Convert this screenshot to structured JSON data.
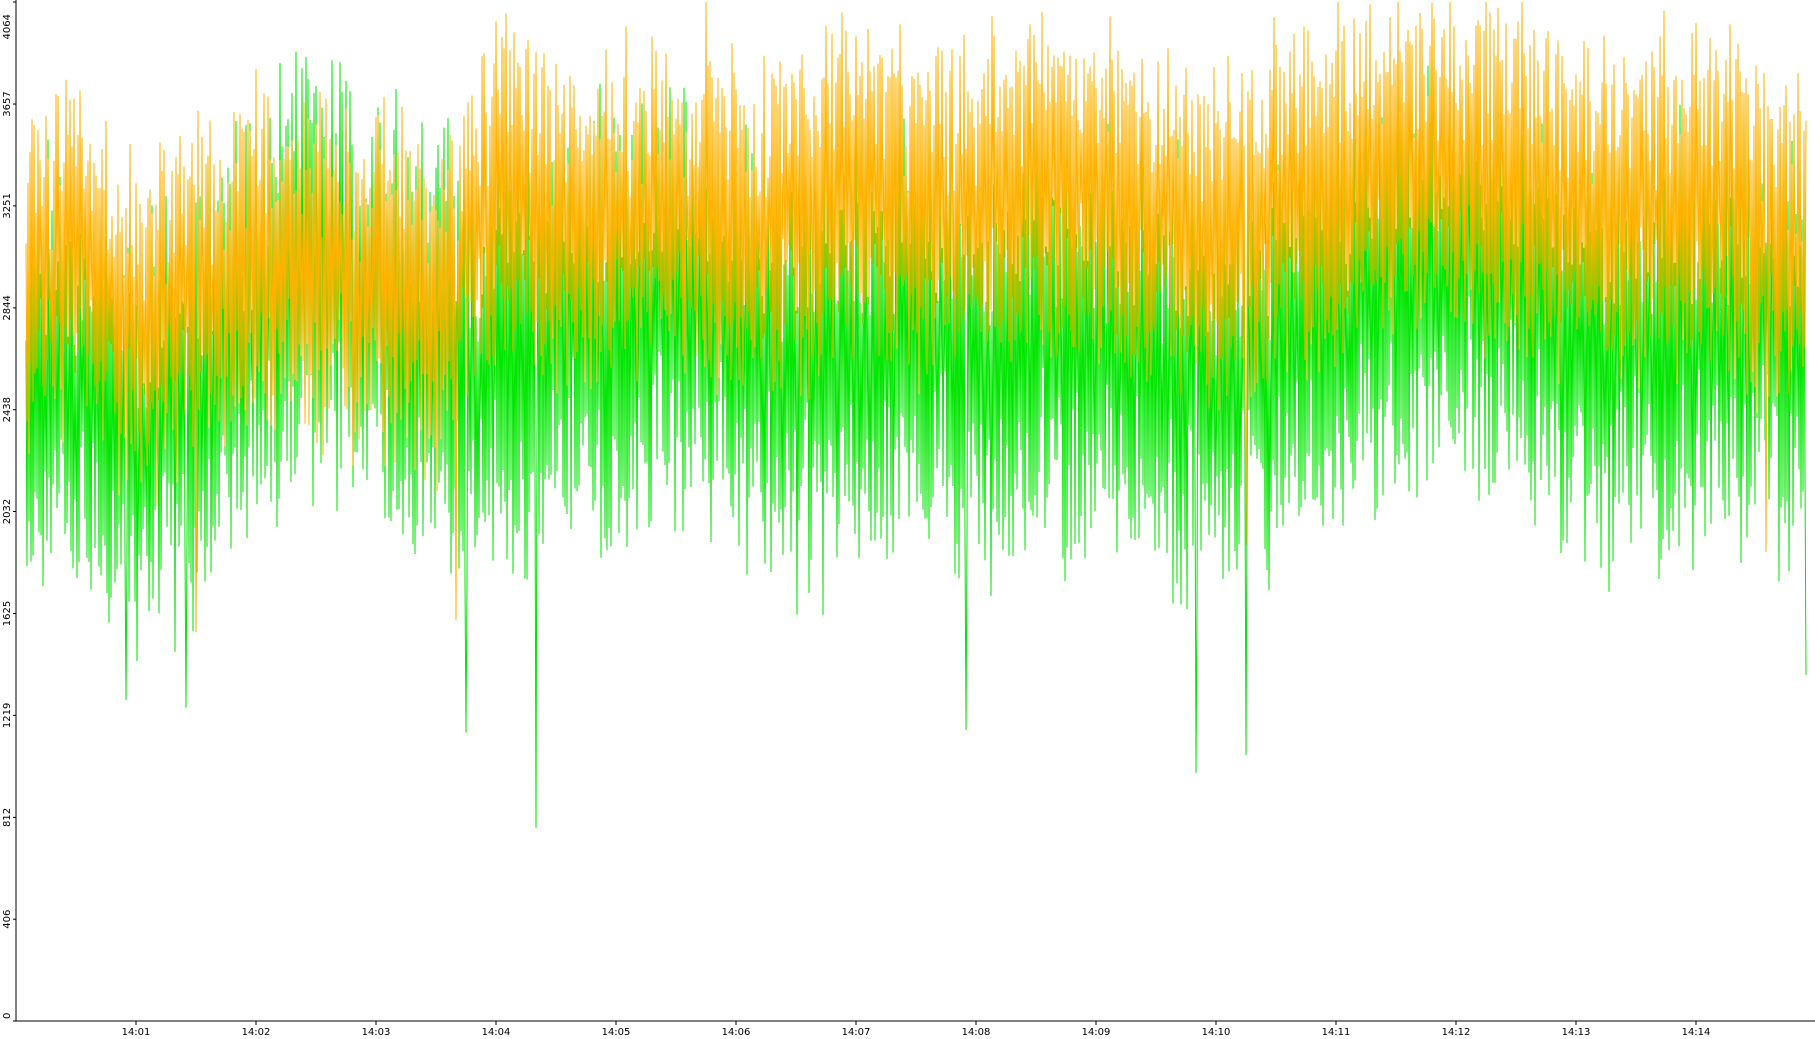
{
  "chart_data": {
    "type": "line",
    "title": "",
    "xlabel": "",
    "ylabel": "",
    "ylim": [
      0,
      4064
    ],
    "y_ticks": [
      "0",
      "406",
      "812",
      "1219",
      "1625",
      "2032",
      "2438",
      "2844",
      "3251",
      "3657",
      "4064"
    ],
    "x_tick_labels": [
      "14:01",
      "14:02",
      "14:03",
      "14:04",
      "14:05",
      "14:06",
      "14:07",
      "14:08",
      "14:09",
      "14:10",
      "14:11",
      "14:12",
      "14:13",
      "14:14"
    ],
    "x_range": [
      "14:00:05",
      "14:14:55"
    ],
    "grid": false,
    "legend": "none",
    "series": [
      {
        "color": "#ffb300",
        "style": "jagged high-frequency line",
        "typical_range": [
          2500,
          3700
        ],
        "mean_profile": [
          [
            "14:00:05",
            2950
          ],
          [
            "14:00:30",
            3100
          ],
          [
            "14:01:00",
            2750
          ],
          [
            "14:01:30",
            2900
          ],
          [
            "14:02:00",
            3050
          ],
          [
            "14:02:30",
            2950
          ],
          [
            "14:03:00",
            3000
          ],
          [
            "14:03:30",
            2850
          ],
          [
            "14:04:00",
            3300
          ],
          [
            "14:04:30",
            3150
          ],
          [
            "14:05:00",
            3200
          ],
          [
            "14:05:30",
            3250
          ],
          [
            "14:06:00",
            3150
          ],
          [
            "14:06:30",
            3200
          ],
          [
            "14:07:00",
            3300
          ],
          [
            "14:07:30",
            3200
          ],
          [
            "14:08:00",
            3250
          ],
          [
            "14:08:30",
            3350
          ],
          [
            "14:09:00",
            3300
          ],
          [
            "14:09:30",
            3200
          ],
          [
            "14:10:00",
            3150
          ],
          [
            "14:10:30",
            3250
          ],
          [
            "14:11:00",
            3300
          ],
          [
            "14:11:30",
            3400
          ],
          [
            "14:12:00",
            3400
          ],
          [
            "14:12:30",
            3300
          ],
          [
            "14:13:00",
            3250
          ],
          [
            "14:13:30",
            3200
          ],
          [
            "14:14:00",
            3300
          ],
          [
            "14:14:30",
            3200
          ],
          [
            "14:14:55",
            3000
          ]
        ],
        "peaks": [
          [
            "14:04:05",
            4020
          ],
          [
            "14:05:45",
            4064
          ],
          [
            "14:06:55",
            3950
          ],
          [
            "14:14:00",
            3980
          ],
          [
            "14:12:20",
            3850
          ]
        ],
        "troughs": [
          [
            "14:03:40",
            1600
          ],
          [
            "14:01:30",
            1550
          ],
          [
            "14:10:15",
            1900
          ],
          [
            "14:14:35",
            1870
          ]
        ]
      },
      {
        "color": "#00e600",
        "style": "jagged high-frequency line",
        "typical_range": [
          1900,
          3400
        ],
        "mean_profile": [
          [
            "14:00:05",
            2600
          ],
          [
            "14:00:30",
            2550
          ],
          [
            "14:01:00",
            2350
          ],
          [
            "14:01:30",
            2450
          ],
          [
            "14:02:00",
            2800
          ],
          [
            "14:02:30",
            3000
          ],
          [
            "14:03:00",
            2800
          ],
          [
            "14:03:30",
            2700
          ],
          [
            "14:04:00",
            2600
          ],
          [
            "14:04:30",
            2800
          ],
          [
            "14:05:00",
            2750
          ],
          [
            "14:05:30",
            2900
          ],
          [
            "14:06:00",
            2750
          ],
          [
            "14:06:30",
            2500
          ],
          [
            "14:07:00",
            2650
          ],
          [
            "14:07:30",
            2750
          ],
          [
            "14:08:00",
            2600
          ],
          [
            "14:08:30",
            2700
          ],
          [
            "14:09:00",
            2650
          ],
          [
            "14:09:30",
            2600
          ],
          [
            "14:10:00",
            2500
          ],
          [
            "14:10:30",
            2650
          ],
          [
            "14:11:00",
            2800
          ],
          [
            "14:11:30",
            2900
          ],
          [
            "14:12:00",
            3000
          ],
          [
            "14:12:30",
            2850
          ],
          [
            "14:13:00",
            2700
          ],
          [
            "14:13:30",
            2650
          ],
          [
            "14:14:00",
            2700
          ],
          [
            "14:14:30",
            2800
          ],
          [
            "14:14:55",
            2600
          ]
        ],
        "peaks": [
          [
            "14:02:45",
            3750
          ],
          [
            "14:12:20",
            3780
          ],
          [
            "14:04:05",
            3600
          ],
          [
            "14:07:00",
            3500
          ]
        ],
        "troughs": [
          [
            "14:04:20",
            770
          ],
          [
            "14:09:50",
            990
          ],
          [
            "14:10:15",
            1060
          ],
          [
            "14:03:45",
            1150
          ],
          [
            "14:07:55",
            1160
          ],
          [
            "14:01:25",
            1250
          ],
          [
            "14:00:55",
            1280
          ],
          [
            "14:14:55",
            1380
          ]
        ]
      }
    ]
  }
}
